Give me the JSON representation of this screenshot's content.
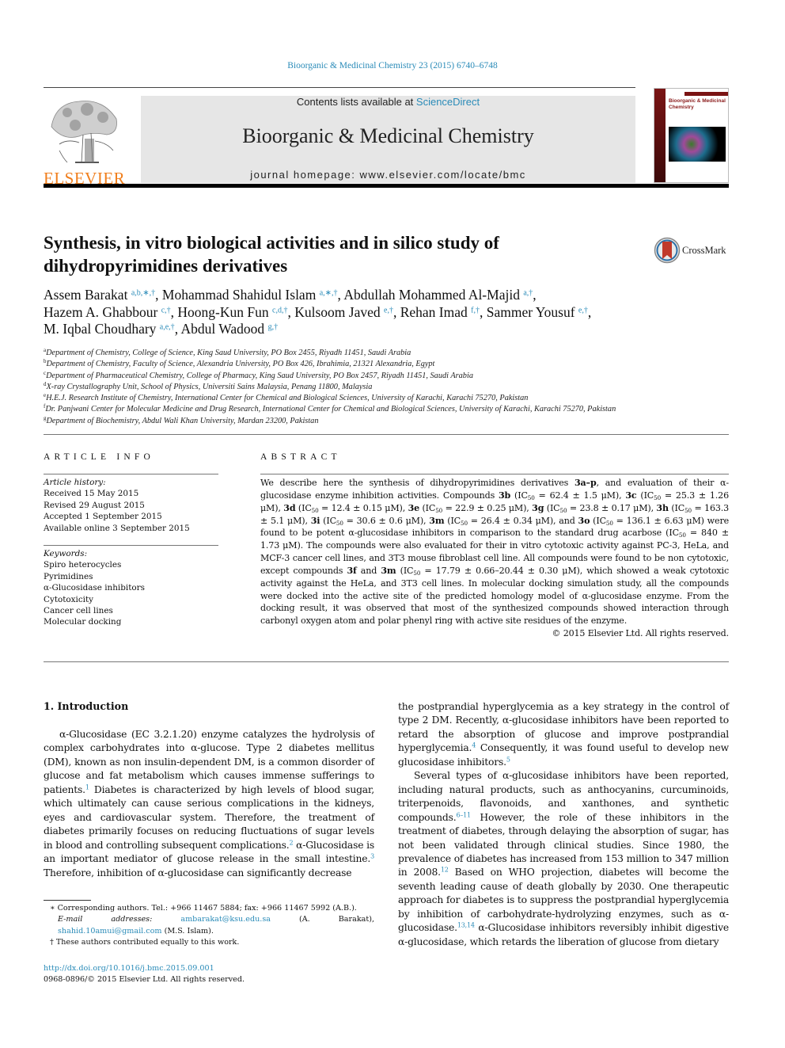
{
  "header": {
    "citation": "Bioorganic & Medicinal Chemistry 23 (2015) 6740–6748",
    "contents_prefix": "Contents lists available at ",
    "contents_link": "ScienceDirect",
    "journal_title": "Bioorganic & Medicinal Chemistry",
    "homepage_prefix": "journal homepage: ",
    "homepage_url": "www.elsevier.com/locate/bmc",
    "publisher_logo_text": "ELSEVIER",
    "cover_title": "Bioorganic & Medicinal Chemistry",
    "brand_color": "#f07e1c",
    "link_color": "#2a8bb8"
  },
  "article": {
    "title_line1": "Synthesis, in vitro biological activities and in silico study of",
    "title_line2": "dihydropyrimidines derivatives",
    "crossmark_label": "CrossMark",
    "authors": [
      {
        "name": "Assem Barakat",
        "marks": "a,b,∗,†",
        "sep": ", "
      },
      {
        "name": "Mohammad Shahidul Islam",
        "marks": "a,∗,†",
        "sep": ", "
      },
      {
        "name": "Abdullah Mohammed Al-Majid",
        "marks": "a,†",
        "sep": ","
      },
      {
        "name": "Hazem A. Ghabbour",
        "marks": "c,†",
        "sep": ", "
      },
      {
        "name": "Hoong-Kun Fun",
        "marks": "c,d,†",
        "sep": ", "
      },
      {
        "name": "Kulsoom Javed",
        "marks": "e,†",
        "sep": ", "
      },
      {
        "name": "Rehan Imad",
        "marks": "f,†",
        "sep": ", "
      },
      {
        "name": "Sammer Yousuf",
        "marks": "e,†",
        "sep": ","
      },
      {
        "name": "M. Iqbal Choudhary",
        "marks": "a,e,†",
        "sep": ", "
      },
      {
        "name": "Abdul Wadood",
        "marks": "g,†",
        "sep": ""
      }
    ],
    "affiliations": [
      {
        "key": "a",
        "text": "Department of Chemistry, College of Science, King Saud University, PO Box 2455, Riyadh 11451, Saudi Arabia"
      },
      {
        "key": "b",
        "text": "Department of Chemistry, Faculty of Science, Alexandria University, PO Box 426, Ibrahimia, 21321 Alexandria, Egypt"
      },
      {
        "key": "c",
        "text": "Department of Pharmaceutical Chemistry, College of Pharmacy, King Saud University, PO Box 2457, Riyadh 11451, Saudi Arabia"
      },
      {
        "key": "d",
        "text": "X-ray Crystallography Unit, School of Physics, Universiti Sains Malaysia, Penang 11800, Malaysia"
      },
      {
        "key": "e",
        "text": "H.E.J. Research Institute of Chemistry, International Center for Chemical and Biological Sciences, University of Karachi, Karachi 75270, Pakistan"
      },
      {
        "key": "f",
        "text": "Dr. Panjwani Center for Molecular Medicine and Drug Research, International Center for Chemical and Biological Sciences, University of Karachi, Karachi 75270, Pakistan"
      },
      {
        "key": "g",
        "text": "Department of Biochemistry, Abdul Wali Khan University, Mardan 23200, Pakistan"
      }
    ]
  },
  "article_info": {
    "heading": "ARTICLE INFO",
    "history_label": "Article history:",
    "history": [
      "Received 15 May 2015",
      "Revised 29 August 2015",
      "Accepted 1 September 2015",
      "Available online 3 September 2015"
    ],
    "keywords_label": "Keywords:",
    "keywords": [
      "Spiro heterocycles",
      "Pyrimidines",
      "α-Glucosidase inhibitors",
      "Cytotoxicity",
      "Cancer cell lines",
      "Molecular docking"
    ]
  },
  "abstract": {
    "heading": "ABSTRACT",
    "segments": [
      {
        "t": "We describe here the synthesis of dihydropyrimidines derivatives "
      },
      {
        "b": "3a–p"
      },
      {
        "t": ", and evaluation of their α-glucosidase enzyme inhibition activities. Compounds "
      },
      {
        "b": "3b"
      },
      {
        "t": " (IC"
      },
      {
        "s": "50"
      },
      {
        "t": " = 62.4 ± 1.5 μM), "
      },
      {
        "b": "3c"
      },
      {
        "t": " (IC"
      },
      {
        "s": "50"
      },
      {
        "t": " = 25.3 ± 1.26 μM), "
      },
      {
        "b": "3d"
      },
      {
        "t": " (IC"
      },
      {
        "s": "50"
      },
      {
        "t": " = 12.4 ± 0.15 μM), "
      },
      {
        "b": "3e"
      },
      {
        "t": " (IC"
      },
      {
        "s": "50"
      },
      {
        "t": " = 22.9 ± 0.25 μM), "
      },
      {
        "b": "3g"
      },
      {
        "t": " (IC"
      },
      {
        "s": "50"
      },
      {
        "t": " = 23.8 ± 0.17 μM), "
      },
      {
        "b": "3h"
      },
      {
        "t": " (IC"
      },
      {
        "s": "50"
      },
      {
        "t": " = 163.3 ± 5.1 μM), "
      },
      {
        "b": "3i"
      },
      {
        "t": " (IC"
      },
      {
        "s": "50"
      },
      {
        "t": " = 30.6 ± 0.6 μM), "
      },
      {
        "b": "3m"
      },
      {
        "t": " (IC"
      },
      {
        "s": "50"
      },
      {
        "t": " = 26.4 ± 0.34 μM), and "
      },
      {
        "b": "3o"
      },
      {
        "t": " (IC"
      },
      {
        "s": "50"
      },
      {
        "t": " = 136.1 ± 6.63 μM) were found to be potent α-glucosidase inhibitors in comparison to the standard drug acarbose (IC"
      },
      {
        "s": "50"
      },
      {
        "t": " = 840 ± 1.73 μM). The compounds were also evaluated for their in vitro cytotoxic activity against PC-3, HeLa, and MCF-3 cancer cell lines, and 3T3 mouse fibroblast cell line. All compounds were found to be non cytotoxic, except compounds "
      },
      {
        "b": "3f"
      },
      {
        "t": " and "
      },
      {
        "b": "3m"
      },
      {
        "t": " (IC"
      },
      {
        "s": "50"
      },
      {
        "t": " = 17.79 ± 0.66–20.44 ± 0.30 μM), which showed a weak cytotoxic activity against the HeLa, and 3T3 cell lines. In molecular docking simulation study, all the compounds were docked into the active site of the predicted homology model of α-glucosidase enzyme. From the docking result, it was observed that most of the synthesized compounds showed interaction through carbonyl oxygen atom and polar phenyl ring with active site residues of the enzyme."
      }
    ],
    "copyright": "© 2015 Elsevier Ltd. All rights reserved."
  },
  "body": {
    "section_heading": "1. Introduction",
    "left_paragraph": [
      {
        "t": "α-Glucosidase (EC 3.2.1.20) enzyme catalyzes the hydrolysis of complex carbohydrates into α-glucose. Type 2 diabetes mellitus (DM), known as non insulin-dependent DM, is a common disorder of glucose and fat metabolism which causes immense sufferings to patients."
      },
      {
        "r": "1"
      },
      {
        "t": " Diabetes is characterized by high levels of blood sugar, which ultimately can cause serious complications in the kidneys, eyes and cardiovascular system. Therefore, the treatment of diabetes primarily focuses on reducing fluctuations of sugar levels in blood and controlling subsequent complications."
      },
      {
        "r": "2"
      },
      {
        "t": " α-Glucosidase is an important mediator of glucose release in the small intestine."
      },
      {
        "r": "3"
      },
      {
        "t": " Therefore, inhibition of α-glucosidase can significantly decrease"
      }
    ],
    "right_paragraph_1": [
      {
        "t": "the postprandial hyperglycemia as a key strategy in the control of type 2 DM. Recently, α-glucosidase inhibitors have been reported to retard the absorption of glucose and improve postprandial hyperglycemia."
      },
      {
        "r": "4"
      },
      {
        "t": " Consequently, it was found useful to develop new glucosidase inhibitors."
      },
      {
        "r": "5"
      }
    ],
    "right_paragraph_2": [
      {
        "t": "Several types of α-glucosidase inhibitors have been reported, including natural products, such as anthocyanins, curcuminoids, triterpenoids, flavonoids, and xanthones, and synthetic compounds."
      },
      {
        "r": "6–11"
      },
      {
        "t": " However, the role of these inhibitors in the treatment of diabetes, through delaying the absorption of sugar, has not been validated through clinical studies. Since 1980, the prevalence of diabetes has increased from 153 million to 347 million in 2008."
      },
      {
        "r": "12"
      },
      {
        "t": " Based on WHO projection, diabetes will become the seventh leading cause of death globally by 2030. One therapeutic approach for diabetes is to suppress the postprandial hyperglycemia by inhibition of carbohydrate-hydrolyzing enzymes, such as α-glucosidase."
      },
      {
        "r": "13,14"
      },
      {
        "t": " α-Glucosidase inhibitors reversibly inhibit digestive α-glucosidase, which retards the liberation of glucose from dietary"
      }
    ]
  },
  "footnotes": {
    "corresponding": "∗ Corresponding authors. Tel.: +966 11467 5884; fax: +966 11467 5992 (A.B.).",
    "email_label": "E-mail addresses: ",
    "email1": "ambarakat@ksu.edu.sa",
    "email1_owner": " (A. Barakat), ",
    "email2": "shahid.10amui@gmail.com",
    "email2_owner": " (M.S. Islam).",
    "equal_contribution": "† These authors contributed equally to this work.",
    "doi": "http://dx.doi.org/10.1016/j.bmc.2015.09.001",
    "issn": "0968-0896/© 2015 Elsevier Ltd. All rights reserved."
  }
}
